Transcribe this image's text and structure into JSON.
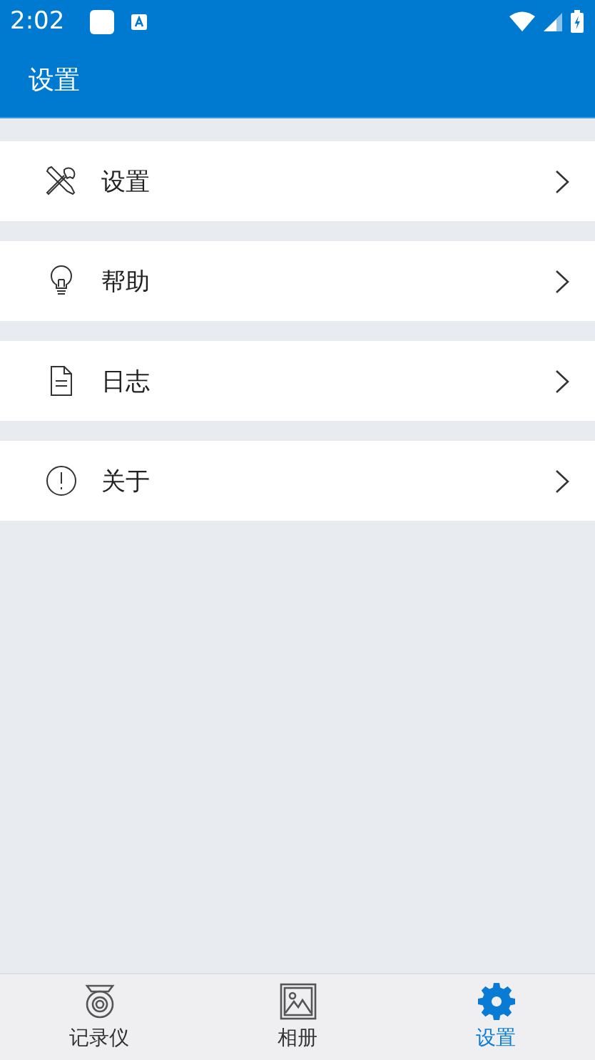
{
  "status_bar": {
    "time": "2:02"
  },
  "toolbar": {
    "title": "设置"
  },
  "menu_items": [
    {
      "label": "设置"
    },
    {
      "label": "帮助"
    },
    {
      "label": "日志"
    },
    {
      "label": "关于"
    }
  ],
  "tabs": [
    {
      "label": "记录仪",
      "selected": false
    },
    {
      "label": "相册",
      "selected": false
    },
    {
      "label": "设置",
      "selected": true
    }
  ]
}
